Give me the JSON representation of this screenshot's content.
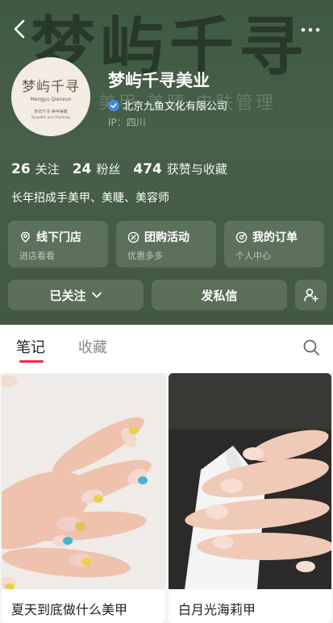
{
  "header": {
    "background_title": "梦屿千寻",
    "background_subtitle": "美甲 美睫 皮肤管理",
    "shop_name": "梦屿千寻美业",
    "verified_company": "北京九鱼文化有限公司",
    "ip_location": "IP：四川",
    "avatar": {
      "name": "梦屿千寻",
      "name_en": "Mengyu Qianxun",
      "tagline": "梦屿千寻  美甲美睫",
      "tagline_en": "Beautiful and Charming"
    }
  },
  "stats": [
    {
      "value": "26",
      "label": "关注"
    },
    {
      "value": "24",
      "label": "粉丝"
    },
    {
      "value": "474",
      "label": "获赞与收藏"
    }
  ],
  "bio": "长年招成手美甲、美睫、美容师",
  "service_cards": [
    {
      "title": "线下门店",
      "subtitle": "进店看看",
      "icon": "location-icon"
    },
    {
      "title": "团购活动",
      "subtitle": "优惠多多",
      "icon": "coupon-icon"
    },
    {
      "title": "我的订单",
      "subtitle": "个人中心",
      "icon": "order-icon"
    }
  ],
  "actions": {
    "follow_label": "已关注",
    "message_label": "发私信"
  },
  "tabs": {
    "notes": "笔记",
    "favorites": "收藏"
  },
  "notes": [
    {
      "title": "夏天到底做什么美甲"
    },
    {
      "title": "白月光海莉甲"
    }
  ],
  "colors": {
    "header_bg": "#42593f",
    "accent": "#ff2442",
    "verify_badge": "#4a86e8"
  }
}
